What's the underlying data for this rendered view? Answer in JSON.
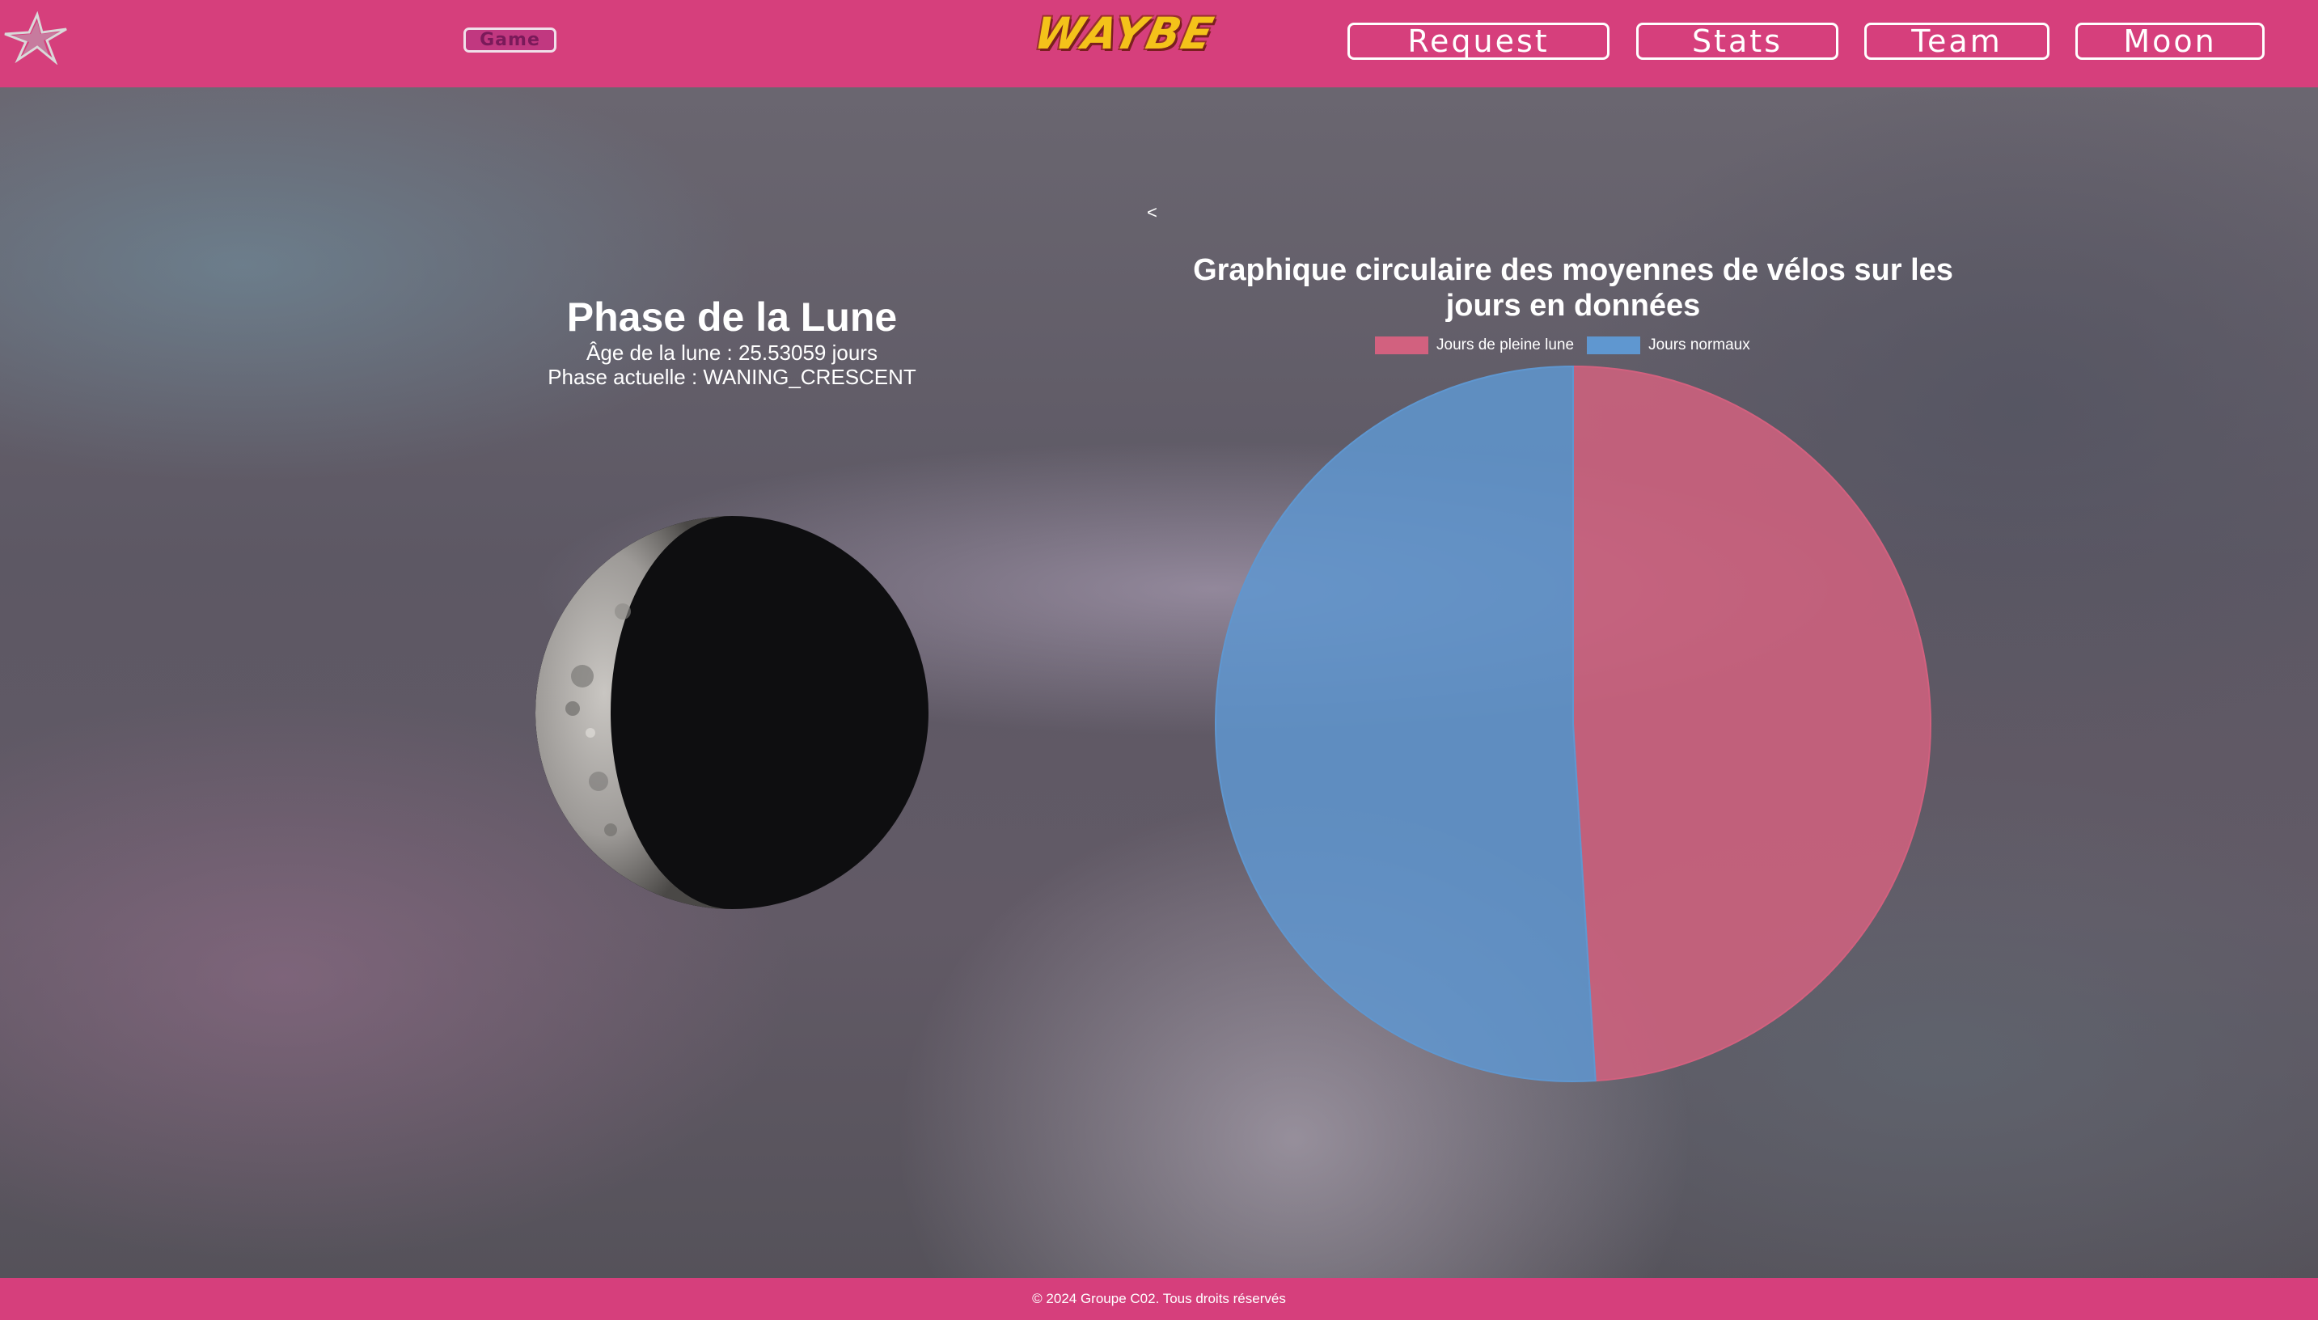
{
  "header": {
    "game_label": "Game",
    "brand": "WAYBE",
    "nav": {
      "request": "Request",
      "stats": "Stats",
      "team": "Team",
      "moon": "Moon"
    }
  },
  "main": {
    "back_symbol": "<",
    "moon": {
      "title": "Phase de la Lune",
      "age_text": "Âge de la lune : 25.53059 jours",
      "phase_text": "Phase actuelle : WANING_CRESCENT"
    }
  },
  "chart_data": {
    "type": "pie",
    "title": "Graphique circulaire des moyennes de vélos sur les jours en données",
    "categories": [
      "Jours de pleine lune",
      "Jours normaux"
    ],
    "values": [
      49,
      51
    ],
    "colors": [
      "#d2617f",
      "#5f97d0"
    ],
    "legend_position": "top"
  },
  "footer": {
    "text": "© 2024 Groupe C02. Tous droits réservés"
  }
}
